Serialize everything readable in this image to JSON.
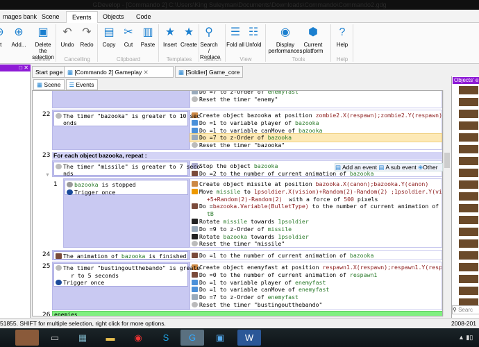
{
  "window": {
    "title": "GDevelop - [Commando 2] C:\\Users\\King Suleyman\\Documents\\Downloads\\Commando\\Commando2.gdg"
  },
  "menu_tabs": [
    "mages bank",
    "Scene",
    "Events",
    "Objects",
    "Code"
  ],
  "ribbon": {
    "buttons": [
      {
        "label": "nt",
        "icon": "add-event-icon"
      },
      {
        "label": "Add...",
        "icon": "add-icon"
      },
      {
        "label": "Delete the selection",
        "icon": "delete-icon"
      },
      {
        "label": "Undo",
        "icon": "undo-icon"
      },
      {
        "label": "Redo",
        "icon": "redo-icon"
      },
      {
        "label": "Copy",
        "icon": "copy-icon"
      },
      {
        "label": "Cut",
        "icon": "cut-icon"
      },
      {
        "label": "Paste",
        "icon": "paste-icon"
      },
      {
        "label": "Insert",
        "icon": "star-icon"
      },
      {
        "label": "Create",
        "icon": "star-plus-icon"
      },
      {
        "label": "Search / Replace",
        "icon": "search-icon"
      },
      {
        "label": "Fold all",
        "icon": "fold-icon"
      },
      {
        "label": "Unfold",
        "icon": "unfold-icon"
      },
      {
        "label": "Display performances",
        "icon": "gauge-icon"
      },
      {
        "label": "Current platform",
        "icon": "platform-icon"
      },
      {
        "label": "Help",
        "icon": "help-icon"
      }
    ],
    "groups": [
      "Delete",
      "Cancelling",
      "Clipboard",
      "Templates",
      "Search",
      "View",
      "Tools",
      "Help"
    ]
  },
  "doc_tabs": [
    "Start page",
    "[Commando 2] Gameplay",
    "[Soldier] Game_core"
  ],
  "sub_tabs": [
    "Scene",
    "Events"
  ],
  "right_panel": {
    "title": "Objects' e",
    "search_placeholder": "Searc"
  },
  "add_bar": {
    "add_event": "Add an event",
    "sub_event": "A sub event",
    "other": "Other"
  },
  "events": {
    "top_actions": [
      {
        "icon": "zorder",
        "seg": [
          [
            "Do =7 to z-Order of ",
            ""
          ],
          [
            "enemyfast",
            "o"
          ]
        ]
      },
      {
        "icon": "timer",
        "seg": [
          [
            "Reset the timer \"enemy\"",
            ""
          ]
        ]
      }
    ],
    "e22": {
      "num": "22",
      "cond": [
        "The timer \"bazooka\" is greater to 10 sec",
        "onds"
      ],
      "actions": [
        {
          "icon": "create",
          "seg": [
            [
              "Create object bazooka at position ",
              ""
            ],
            [
              "zombie2.X(respawn);zombie2.Y(respawn)",
              "x"
            ]
          ]
        },
        {
          "icon": "var",
          "seg": [
            [
              "Do =1 to variable player of ",
              ""
            ],
            [
              "bazooka",
              "o"
            ]
          ]
        },
        {
          "icon": "var",
          "seg": [
            [
              "Do =1 to variable canMove of ",
              ""
            ],
            [
              "bazooka",
              "o"
            ]
          ]
        },
        {
          "icon": "zorder",
          "hl": true,
          "seg": [
            [
              "Do =7 to z-Order of ",
              ""
            ],
            [
              "bazooka",
              "o"
            ]
          ]
        },
        {
          "icon": "timer",
          "seg": [
            [
              "Reset the timer \"bazooka\"",
              ""
            ]
          ]
        }
      ]
    },
    "e23": {
      "num": "23",
      "header": "For each object bazooka, repeat :",
      "cond": [
        "The timer \"missile\" is greater to 7 seco",
        "nds"
      ],
      "actions": [
        {
          "icon": "stop",
          "seg": [
            [
              "Stop the object ",
              ""
            ],
            [
              "bazooka",
              "o"
            ]
          ]
        },
        {
          "icon": "anim",
          "seg": [
            [
              "Do =2 to the number of current animation of ",
              ""
            ],
            [
              "bazooka",
              "o"
            ]
          ]
        }
      ]
    },
    "sub1": {
      "num": "1",
      "cond": [
        {
          "icon": "stopped",
          "seg": [
            [
              "bazooka",
              "o"
            ],
            [
              " is stopped",
              ""
            ]
          ]
        },
        {
          "icon": "once",
          "seg": [
            [
              "Trigger once",
              ""
            ]
          ]
        }
      ],
      "actions": [
        {
          "icon": "create",
          "seg": [
            [
              "Create object missile at position ",
              ""
            ],
            [
              "bazooka.X(canon);bazooka.Y(canon)",
              "x"
            ]
          ]
        },
        {
          "icon": "move",
          "seg": [
            [
              "Move ",
              ""
            ],
            [
              "missile",
              "o"
            ],
            [
              " to ",
              ""
            ],
            [
              "1psoldier.X(vision)+Random(2)-Random(2) ;1psoldier.Y(vision)",
              "x"
            ]
          ]
        },
        {
          "icon": "",
          "seg": [
            [
              "+5+Random(2)-Random(2)",
              "x"
            ],
            [
              "  with a force of ",
              ""
            ],
            [
              "500",
              "x"
            ],
            [
              " pixels",
              ""
            ]
          ]
        },
        {
          "icon": "anim",
          "seg": [
            [
              "Do =",
              ""
            ],
            [
              "bazooka.Variable(BulletType)",
              "x"
            ],
            [
              " to the number of current animation of ",
              ""
            ],
            [
              "Bulle",
              "o"
            ]
          ]
        },
        {
          "icon": "",
          "seg": [
            [
              "tB",
              "o"
            ]
          ]
        },
        {
          "icon": "rotate",
          "seg": [
            [
              "Rotate ",
              ""
            ],
            [
              "missile",
              "o"
            ],
            [
              " towards ",
              ""
            ],
            [
              "1psoldier",
              "o"
            ]
          ]
        },
        {
          "icon": "zorder",
          "seg": [
            [
              "Do =9 to z-Order of ",
              ""
            ],
            [
              "missile",
              "o"
            ]
          ]
        },
        {
          "icon": "rotate",
          "seg": [
            [
              "Rotate ",
              ""
            ],
            [
              "bazooka",
              "o"
            ],
            [
              " towards ",
              ""
            ],
            [
              "1psoldier",
              "o"
            ]
          ]
        },
        {
          "icon": "timer",
          "seg": [
            [
              "Reset the timer \"missile\"",
              ""
            ]
          ]
        }
      ]
    },
    "e24": {
      "num": "24",
      "cond": [
        {
          "icon": "anim",
          "seg": [
            [
              "The animation of ",
              ""
            ],
            [
              "bazooka",
              "o"
            ],
            [
              " is finished",
              ""
            ]
          ]
        }
      ],
      "actions": [
        {
          "icon": "anim",
          "seg": [
            [
              "Do =1 to the number of current animation of ",
              ""
            ],
            [
              "bazooka",
              "o"
            ]
          ]
        }
      ]
    },
    "e25": {
      "num": "25",
      "cond": [
        {
          "icon": "timer",
          "seg": [
            [
              "The timer \"bustingoutthebando\" is greate",
              ""
            ]
          ]
        },
        {
          "icon": "",
          "seg": [
            [
              "r to 5 seconds",
              ""
            ]
          ]
        },
        {
          "icon": "once",
          "seg": [
            [
              "Trigger once",
              ""
            ]
          ]
        }
      ],
      "actions": [
        {
          "icon": "create",
          "seg": [
            [
              "Create object enemyfast at position ",
              ""
            ],
            [
              "respawn1.X(respawn);respawn1.Y(respawn)",
              "x"
            ]
          ]
        },
        {
          "icon": "anim",
          "seg": [
            [
              "Do =0 to the number of current animation of ",
              ""
            ],
            [
              "respawn1",
              "o"
            ]
          ]
        },
        {
          "icon": "var",
          "seg": [
            [
              "Do =1 to variable player of ",
              ""
            ],
            [
              "enemyfast",
              "o"
            ]
          ]
        },
        {
          "icon": "var",
          "seg": [
            [
              "Do =1 to variable canMove of ",
              ""
            ],
            [
              "enemyfast",
              "o"
            ]
          ]
        },
        {
          "icon": "zorder",
          "seg": [
            [
              "Do =7 to z-Order of ",
              ""
            ],
            [
              "enemyfast",
              "o"
            ]
          ]
        },
        {
          "icon": "timer",
          "seg": [
            [
              "Reset the timer \"bustingoutthebando\"",
              ""
            ]
          ]
        }
      ]
    },
    "e26": {
      "num": "26",
      "comment": "enemies"
    }
  },
  "status": {
    "text": "51855. SHIFT for multiple selection, right click for more options.",
    "copyright": "2008-201"
  },
  "colors": {
    "event_bg": "#c9c9f2",
    "accent_purple": "#8e1bd6",
    "comment_green": "#80f080",
    "highlight": "#fde9b6"
  }
}
